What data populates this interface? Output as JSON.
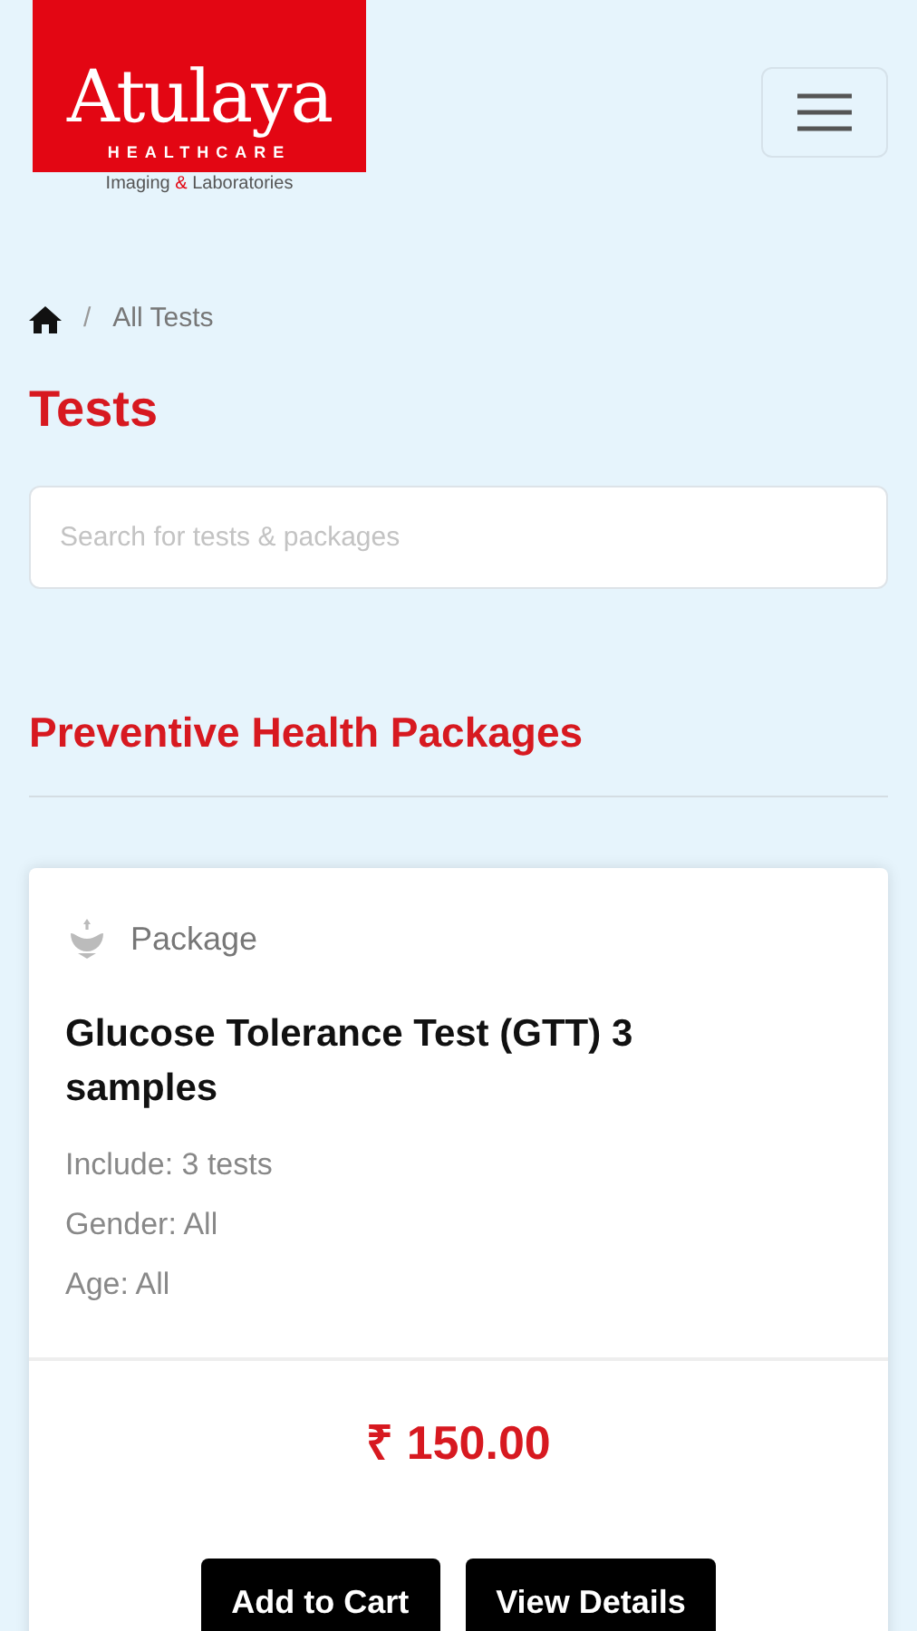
{
  "logo": {
    "name": "Atulaya",
    "subtitle": "HEALTHCARE",
    "tagline": [
      "Imaging",
      "&",
      "Laboratories"
    ]
  },
  "breadcrumb": {
    "separator": "/",
    "current": "All Tests"
  },
  "title": "Tests",
  "search": {
    "placeholder": "Search for tests & packages"
  },
  "section_title": "Preventive Health Packages",
  "cards": [
    {
      "type_label": "Package",
      "name": "Glucose Tolerance Test (GTT) 3 samples",
      "details": [
        "Include: 3 tests",
        "Gender: All",
        "Age: All"
      ],
      "price": "₹ 150.00",
      "buttons": [
        "Add to Cart",
        "View Details"
      ]
    }
  ]
}
